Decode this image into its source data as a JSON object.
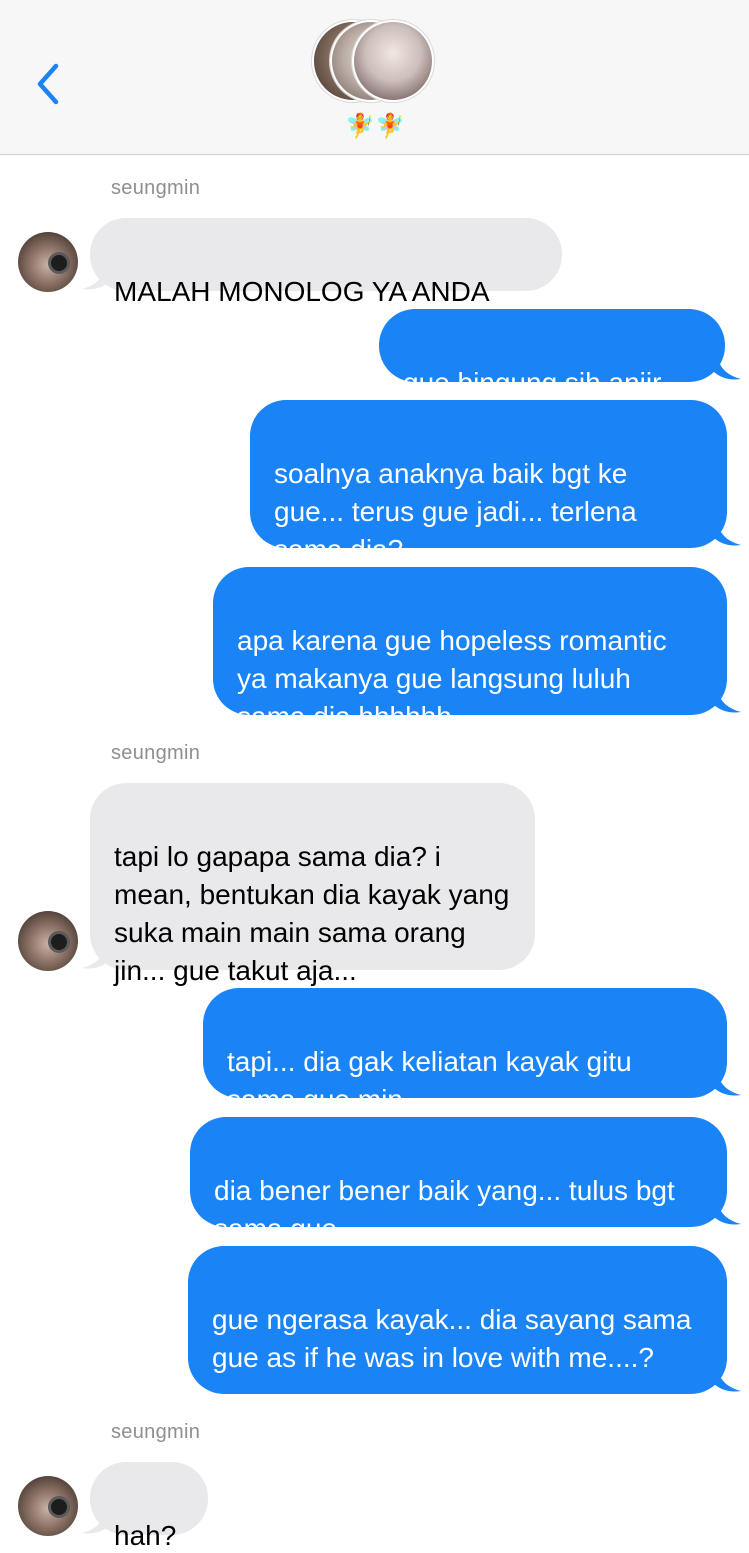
{
  "header": {
    "group_emoji": "🧚🧚",
    "back_icon": "chevron-left-icon",
    "accent_color": "#1a84f6"
  },
  "messages": [
    {
      "sender": "seungmin",
      "direction": "in",
      "text": "MALAH MONOLOG YA ANDA"
    },
    {
      "direction": "out",
      "text": "gue bingung sih anjir"
    },
    {
      "direction": "out",
      "text": "soalnya anaknya baik bgt ke gue... terus gue jadi... terlena sama dia?"
    },
    {
      "direction": "out",
      "text": "apa karena gue hopeless romantic ya makanya gue langsung luluh sama dia hhhhhh"
    },
    {
      "sender": "seungmin",
      "direction": "in",
      "text": "tapi lo gapapa sama dia? i mean, bentukan dia kayak yang suka main main sama orang jin... gue takut aja..."
    },
    {
      "direction": "out",
      "text": "tapi... dia gak keliatan kayak gitu sama gue min..."
    },
    {
      "direction": "out",
      "text": "dia bener bener baik yang... tulus bgt sama gue"
    },
    {
      "direction": "out",
      "text": "gue ngerasa kayak... dia sayang sama gue as if he was in love with me....?"
    },
    {
      "sender": "seungmin",
      "direction": "in",
      "text": "hah?"
    }
  ],
  "colors": {
    "incoming_bubble": "#e9e9eb",
    "outgoing_bubble": "#1a84f6",
    "sender_label": "#8e8e93"
  }
}
